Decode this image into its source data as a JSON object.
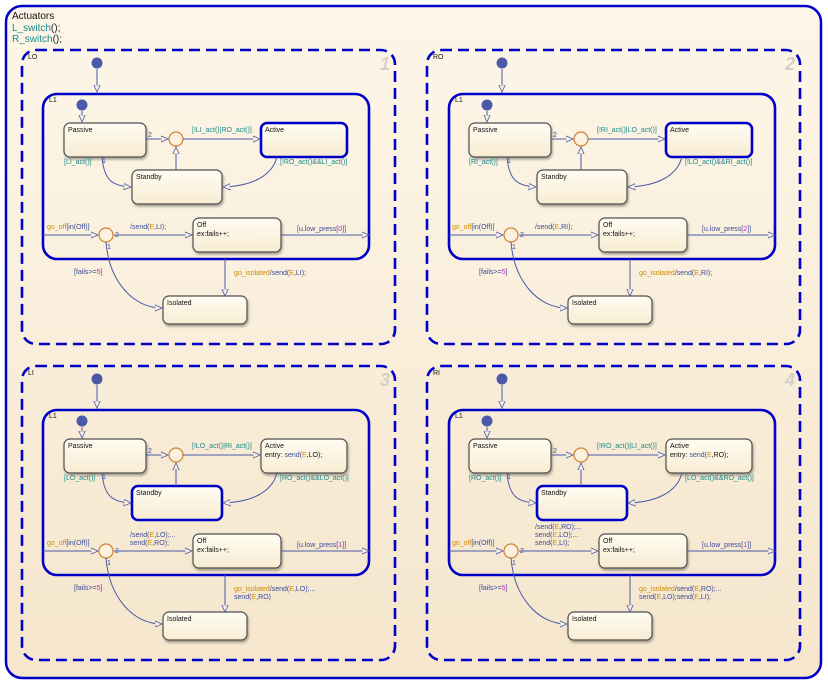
{
  "chart": {
    "title": "Actuators",
    "functions": [
      {
        "name": "L_switch",
        "suffix": "();"
      },
      {
        "name": "R_switch",
        "suffix": "();"
      }
    ],
    "colors": {
      "background": "#fbf1de",
      "outer_border": "#0000c8",
      "state_border": "#505050",
      "junction": "#d08030",
      "transition": "#4a5aa8",
      "default_dot": "#4a5aa8",
      "guard_text": "#1c8a8a",
      "event_text": "#d08c00",
      "number_text": "#d020c0"
    },
    "panels": [
      {
        "id": "LO",
        "label": "LO",
        "number": "1",
        "inner_label": "L1",
        "active_state": "Active",
        "states": {
          "passive": {
            "name": "Passive",
            "body": ""
          },
          "standby": {
            "name": "Standby",
            "body": ""
          },
          "active": {
            "name": "Active",
            "body": ""
          },
          "off": {
            "name": "Off",
            "body": "ex:fails++;"
          },
          "isolated": {
            "name": "Isolated",
            "body": ""
          }
        },
        "transitions": {
          "passive_to_junction_order": "2",
          "passive_to_standby_order": "1",
          "passive_to_standby": "[LI_act()]",
          "junction_to_active": "[!LI_act()|RO_act()]",
          "active_to_standby": "[!RO_act()&&LI_act()]",
          "go_off_event": "go_off",
          "go_off_guard": "[in(Off)]",
          "junction2_to_off_order": "2",
          "junction2_to_isolated_order": "1",
          "to_off_action": [
            "/send(E,LI);"
          ],
          "off_exit": "[u.low_press[0]]",
          "fails_guard": "[fails>=5]",
          "go_isolated_event": "go_isolated",
          "go_isolated_action": [
            "/send(E,LI);"
          ]
        }
      },
      {
        "id": "RO",
        "label": "RO",
        "number": "2",
        "inner_label": "L1",
        "active_state": "Active",
        "states": {
          "passive": {
            "name": "Passive",
            "body": ""
          },
          "standby": {
            "name": "Standby",
            "body": ""
          },
          "active": {
            "name": "Active",
            "body": ""
          },
          "off": {
            "name": "Off",
            "body": "ex:fails++;"
          },
          "isolated": {
            "name": "Isolated",
            "body": ""
          }
        },
        "transitions": {
          "passive_to_junction_order": "2",
          "passive_to_standby_order": "1",
          "passive_to_standby": "[RI_act()]",
          "junction_to_active": "[!RI_act()|LO_act()]",
          "active_to_standby": "[!LO_act()&&RI_act()]",
          "go_off_event": "go_off",
          "go_off_guard": "[in(Off)]",
          "junction2_to_off_order": "2",
          "junction2_to_isolated_order": "1",
          "to_off_action": [
            "/send(E,RI);"
          ],
          "off_exit": "[u.low_press[2]]",
          "fails_guard": "[fails>=5]",
          "go_isolated_event": "go_isolated",
          "go_isolated_action": [
            "/send(E,RI);"
          ]
        }
      },
      {
        "id": "LI",
        "label": "LI",
        "number": "3",
        "inner_label": "L1",
        "active_state": "Standby",
        "states": {
          "passive": {
            "name": "Passive",
            "body": ""
          },
          "standby": {
            "name": "Standby",
            "body": ""
          },
          "active": {
            "name": "Active",
            "body": "entry: send(E,LO);"
          },
          "off": {
            "name": "Off",
            "body": "ex:fails++;"
          },
          "isolated": {
            "name": "Isolated",
            "body": ""
          }
        },
        "transitions": {
          "passive_to_junction_order": "2",
          "passive_to_standby_order": "1",
          "passive_to_standby": "[LO_act()]",
          "junction_to_active": "[!LO_act()|RI_act()]",
          "active_to_standby": "[RO_act()&&LO_act()]",
          "go_off_event": "go_off",
          "go_off_guard": "[in(Off)]",
          "junction2_to_off_order": "2",
          "junction2_to_isolated_order": "1",
          "to_off_action": [
            "/send(E,LO);...",
            "send(E,RO);"
          ],
          "off_exit": "[u.low_press[1]]",
          "fails_guard": "[fails>=5]",
          "go_isolated_event": "go_isolated",
          "go_isolated_action": [
            "/send(E,LO);...",
            "send(E,RO)"
          ]
        }
      },
      {
        "id": "RI",
        "label": "RI",
        "number": "4",
        "inner_label": "L1",
        "active_state": "Standby",
        "states": {
          "passive": {
            "name": "Passive",
            "body": ""
          },
          "standby": {
            "name": "Standby",
            "body": ""
          },
          "active": {
            "name": "Active",
            "body": "entry: send(E,RO);"
          },
          "off": {
            "name": "Off",
            "body": "ex:fails++;"
          },
          "isolated": {
            "name": "Isolated",
            "body": ""
          }
        },
        "transitions": {
          "passive_to_junction_order": "2",
          "passive_to_standby_order": "1",
          "passive_to_standby": "[RO_act()]",
          "junction_to_active": "[!RO_act()|LI_act()]",
          "active_to_standby": "[LO_act()&&RO_act()]",
          "go_off_event": "go_off",
          "go_off_guard": "[in(Off)]",
          "junction2_to_off_order": "2",
          "junction2_to_isolated_order": "1",
          "to_off_action": [
            "/send(E,RO);...",
            "send(E,LO);...",
            "send(E,LI);"
          ],
          "off_exit": "[u.low_press[1]]",
          "fails_guard": "[fails>=5]",
          "go_isolated_event": "go_isolated",
          "go_isolated_action": [
            "/send(E,RO);...",
            "send(E,LO);send(E,LI);"
          ]
        }
      }
    ]
  }
}
